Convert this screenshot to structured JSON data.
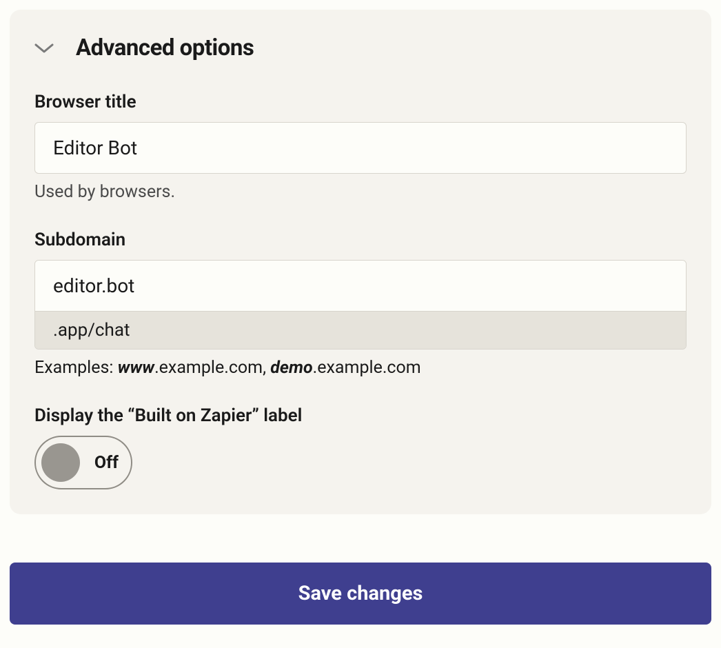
{
  "section": {
    "title": "Advanced options"
  },
  "browserTitle": {
    "label": "Browser title",
    "value": "Editor Bot",
    "helper": "Used by browsers."
  },
  "subdomain": {
    "label": "Subdomain",
    "value": "editor.bot",
    "suffix": ".app/chat",
    "examplesPrefix": "Examples: ",
    "example1Bold": "www",
    "example1Rest": ".example.com, ",
    "example2Bold": "demo",
    "example2Rest": ".example.com"
  },
  "builtOnZapier": {
    "label": "Display the “Built on Zapier” label",
    "toggleState": "Off"
  },
  "actions": {
    "save": "Save changes"
  }
}
